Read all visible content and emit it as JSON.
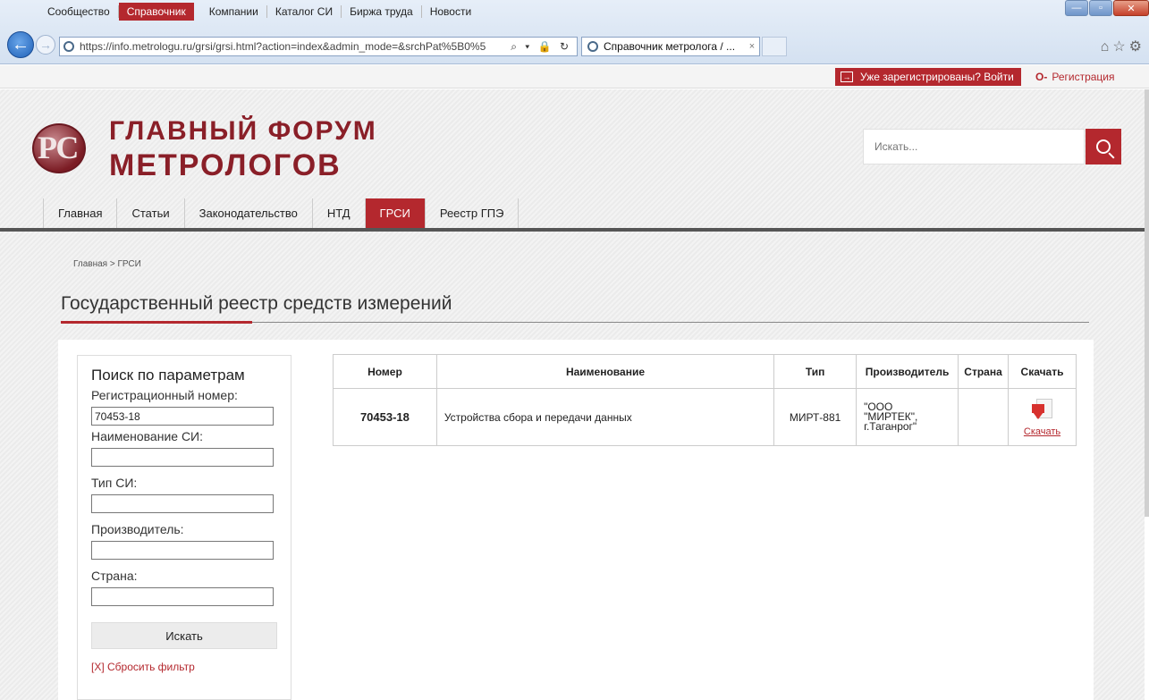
{
  "browser": {
    "url": "https://info.metrologu.ru/grsi/grsi.html?action=index&admin_mode=&srchPat%5B0%5",
    "address_tools": "⌕ ▾ 🔒 ↻",
    "tab_title": "Справочник метролога / ...",
    "tab_close": "×",
    "back": "←",
    "forward": "→",
    "window_buttons": [
      "—",
      "▫",
      "✕"
    ],
    "toolbar_icons": [
      "home-icon",
      "star-icon",
      "gear-icon"
    ]
  },
  "topnav": {
    "items": [
      "Сообщество",
      "Справочник",
      "Компании",
      "Каталог СИ",
      "Биржа труда",
      "Новости"
    ],
    "active_index": 1,
    "login_label": "Уже зарегистрированы? Войти",
    "register_label": "Регистрация"
  },
  "header": {
    "logo_letters": "РС",
    "logo_line1": "ГЛАВНЫЙ ФОРУМ",
    "logo_line2": "МЕТРОЛОГОВ",
    "search_placeholder": "Искать..."
  },
  "mainnav": {
    "items": [
      "Главная",
      "Статьи",
      "Законодательство",
      "НТД",
      "ГРСИ",
      "Реестр ГПЭ"
    ],
    "active_index": 4
  },
  "breadcrumb": "Главная > ГРСИ",
  "page_title": "Государственный реестр средств измерений",
  "filter": {
    "title": "Поиск по параметрам",
    "reg_number_label": "Регистрационный номер:",
    "reg_number_value": "70453-18",
    "name_label": "Наименование СИ:",
    "type_label": "Тип СИ:",
    "manufacturer_label": "Производитель:",
    "country_label": "Страна:",
    "search_button": "Искать",
    "reset_link": "[X] Сбросить фильтр"
  },
  "table": {
    "headers": [
      "Номер",
      "Наименование",
      "Тип",
      "Производитель",
      "Страна",
      "Скачать"
    ],
    "rows": [
      {
        "number": "70453-18",
        "name": "Устройства сбора и передачи данных",
        "type": "МИРТ-881",
        "manufacturer_l1": "\"ООО",
        "manufacturer_l2": "\"МИРТЕК\",",
        "manufacturer_l3": "г.Таганрог\"",
        "country": "",
        "download_label": "Скачать"
      }
    ]
  },
  "colors": {
    "accent": "#b4282e"
  }
}
